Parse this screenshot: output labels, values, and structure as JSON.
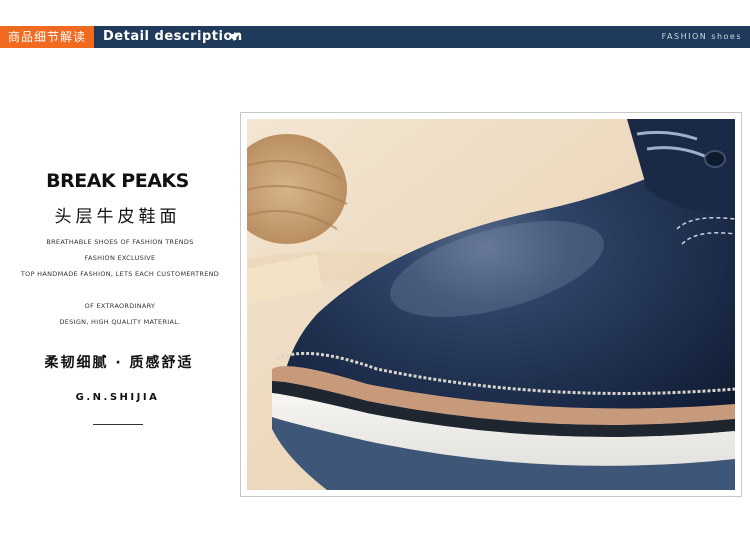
{
  "header": {
    "cn_label": "商品细节解读",
    "en_label": "Detail description",
    "right_label": "FASHION shoes"
  },
  "left": {
    "brand": "BREAK PEAKS",
    "cn_title": "头层牛皮鞋面",
    "lines": [
      "BREATHABLE SHOES OF FASHION TRENDS",
      "FASHION EXCLUSIVE",
      "TOP HANDMADE FASHION, LETS EACH CUSTOMERTREND",
      "OF EXTRAORDINARY",
      "DESIGN, HIGH QUALITY MATERIAL."
    ],
    "cn_sub": "柔韧细腻 · 质感舒适",
    "signature": "G.N.SHIJIA"
  },
  "colors": {
    "header_bg": "#1f3a5a",
    "tag_bg": "#f06a1f",
    "leather": "#1e3050"
  },
  "photo": {
    "subject": "shoe-closeup-image"
  }
}
